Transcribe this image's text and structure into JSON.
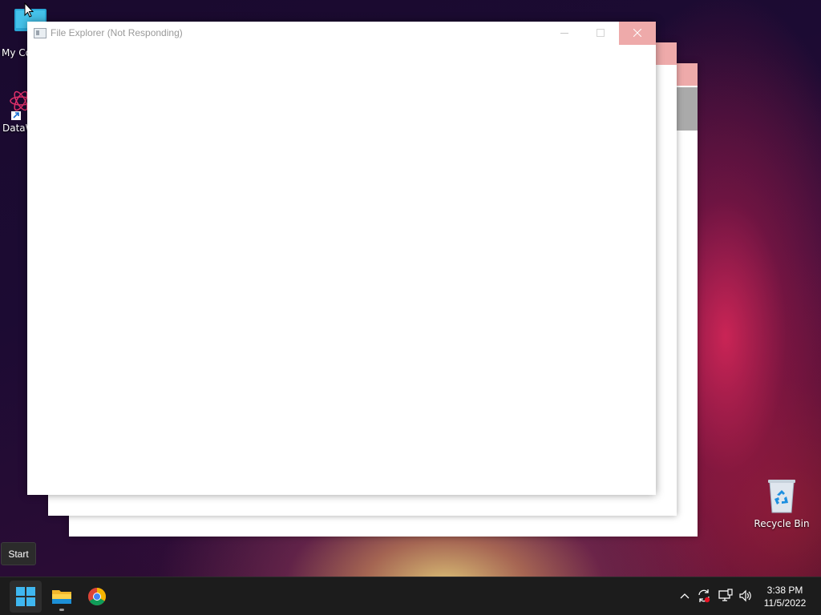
{
  "desktop": {
    "icons": [
      {
        "name": "my-computer",
        "label": "My Computer"
      },
      {
        "name": "datawrapper",
        "label": "DataWrapper"
      },
      {
        "name": "recycle-bin",
        "label": "Recycle Bin"
      }
    ]
  },
  "window": {
    "title": "File Explorer (Not Responding)"
  },
  "tooltip": {
    "text": "Start"
  },
  "taskbar": {
    "items": [
      {
        "name": "start",
        "icon": "windows-logo-icon"
      },
      {
        "name": "file-explorer",
        "icon": "folder-icon",
        "running": true
      },
      {
        "name": "chrome",
        "icon": "chrome-icon"
      }
    ],
    "clock": {
      "time": "3:38 PM",
      "date": "11/5/2022"
    }
  },
  "colors": {
    "taskbar_bg": "#1c1c1c",
    "close_button_pale": "#eeaaaa",
    "title_text_dim": "#9a9a9a"
  }
}
